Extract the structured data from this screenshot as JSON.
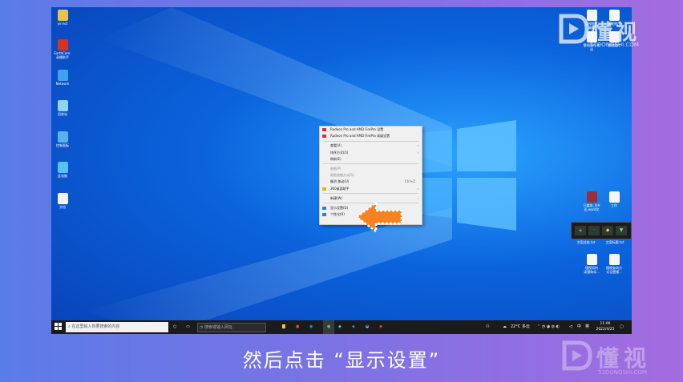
{
  "desktop_icons_left": [
    {
      "name": "icon-user-folder",
      "label": "yin-kit",
      "color": "#e8c34a"
    },
    {
      "name": "icon-recorder",
      "label": "EarthCam-\n录播助手",
      "color": "#d9311f"
    },
    {
      "name": "icon-network",
      "label": "Network",
      "color": "#3ea2f2"
    },
    {
      "name": "icon-recycle-bin",
      "label": "回收站",
      "color": "#8fd3f8"
    },
    {
      "name": "icon-control-panel",
      "label": "控制面板",
      "color": "#56b3f0"
    },
    {
      "name": "icon-this-pc",
      "label": "此电脑",
      "color": "#57c0f5"
    },
    {
      "name": "icon-document",
      "label": "文档",
      "color": "#f4f4f4"
    }
  ],
  "desktop_icons_top_right": [
    {
      "name": "icon-doc-a",
      "label": "懂视图片\n编辑",
      "color": "#f6f6f6"
    },
    {
      "name": "icon-doc-b",
      "label": "懂视图片",
      "color": "#f6f6f6"
    },
    {
      "name": "icon-doc-c",
      "label": "懂视图片 传\n送",
      "color": "#f6f6f6"
    },
    {
      "name": "icon-doc-d",
      "label": "懂视图片",
      "color": "#f6f6f6"
    }
  ],
  "desktop_icons_bottom_right": [
    {
      "name": "icon-winrar",
      "label": "已重命_为H\n出 word文",
      "color": "#9b2e3c"
    },
    {
      "name": "icon-work-doc",
      "label": "工作",
      "color": "#f6f6f6"
    },
    {
      "name": "icon-file-e",
      "label": "懂视如何\n读懂和实...",
      "color": "#f6f6f6"
    },
    {
      "name": "icon-file-f",
      "label": "懂视查询方\n式设置懂...",
      "color": "#f6f6f6"
    }
  ],
  "mini_toolbar": {
    "label_a": "文案总结.txt",
    "label_b": "文案标题.txt"
  },
  "context_menu": [
    {
      "type": "item",
      "label": "Radeon Pro and AMD FirePro 设置",
      "icon": "#d32f2f"
    },
    {
      "type": "item",
      "label": "Radeon Pro and AMD FirePro 高级设置",
      "icon": "#d32f2f"
    },
    {
      "type": "sep"
    },
    {
      "type": "item",
      "label": "查看(V)",
      "arrow": "›"
    },
    {
      "type": "item",
      "label": "排序方式(O)",
      "arrow": "›"
    },
    {
      "type": "item",
      "label": "刷新(E)"
    },
    {
      "type": "sep"
    },
    {
      "type": "item",
      "label": "粘贴(P)",
      "disabled": true
    },
    {
      "type": "item",
      "label": "粘贴快捷方式(S)",
      "disabled": true
    },
    {
      "type": "item",
      "label": "撤消 移动(U)",
      "shortcut": "Ctrl+Z"
    },
    {
      "type": "item",
      "label": "360桌面助手",
      "arrow": "›",
      "icon": "#f2b300"
    },
    {
      "type": "sep"
    },
    {
      "type": "item",
      "label": "新建(W)",
      "arrow": "›"
    },
    {
      "type": "sep"
    },
    {
      "type": "item",
      "label": "显示设置(D)",
      "icon": "#3b78d8"
    },
    {
      "type": "item",
      "label": "个性化(R)",
      "icon": "#3b78d8"
    }
  ],
  "taskbar": {
    "search_placeholder": "在这里输入你要搜索的内容",
    "address_placeholder": "搜索或输入网址",
    "weather": "22°C 多云",
    "ime": "中",
    "lang": "英",
    "time": "11:06",
    "date": "2022/4/25"
  },
  "watermark": {
    "brand": "懂视",
    "url": "51DONGSHI.COM"
  },
  "subtitle": "然后点击 “显示设置”",
  "colors": {
    "arrow": "#f5821f",
    "taskbar": "#1b1b1b",
    "menu_bg": "#f0f0f0"
  }
}
